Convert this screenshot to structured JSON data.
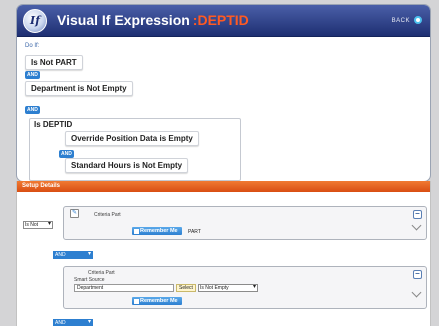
{
  "header": {
    "title": "Visual If Expression",
    "title_accent": ":DEPTID",
    "back_label": "BACK"
  },
  "expression": {
    "do_if_label": "Do If:",
    "items": [
      {
        "text": "Is Not PART"
      },
      {
        "text": "Department is Not Empty"
      },
      {
        "text": "Is DEPTID"
      },
      {
        "text": "Override Position Data is Empty"
      },
      {
        "text": "Standard Hours is Not Empty"
      }
    ],
    "and_labels": [
      "AND",
      "AND",
      "AND"
    ]
  },
  "setup": {
    "section_title": "Setup Details",
    "operator_select": "Is Not",
    "criteria1": {
      "label": "Criteria Part",
      "remember_label": "Remember Me",
      "value": "PART"
    },
    "and_select1": "AND",
    "criteria2": {
      "label": "Criteria Part",
      "smart_source_label": "Smart Source",
      "source_value": "Department",
      "select_button": "Select",
      "condition_select": "Is Not Empty",
      "remember_label": "Remember Me"
    },
    "and_select2": "AND"
  }
}
